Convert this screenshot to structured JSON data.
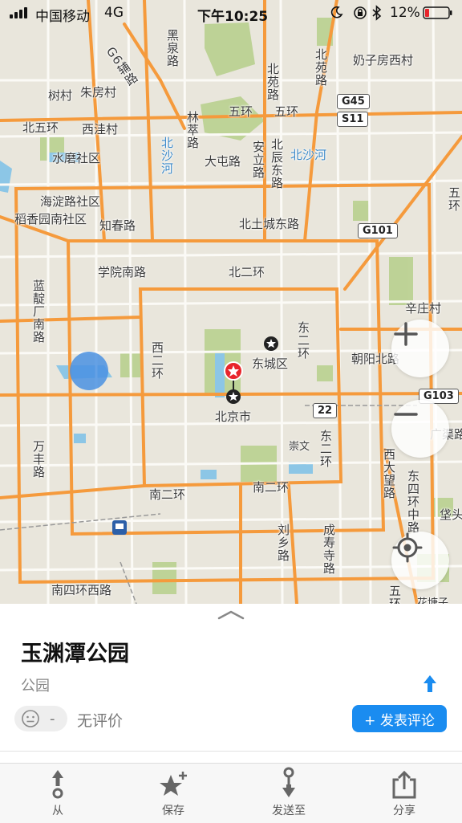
{
  "status_bar": {
    "carrier": "中国移动",
    "network": "4G",
    "time": "下午10:25",
    "battery": "12%"
  },
  "map": {
    "labels": {
      "heiquan": "黑泉路",
      "naizifang": "奶子房西村",
      "shufang": "树村",
      "zhufang": "朱房村",
      "beiwuhuan": "北五环",
      "xiwa": "西洼村",
      "wuhuan1": "五环",
      "wuhuan2": "五环",
      "dachun": "大屯路",
      "shuimo": "水磨社区",
      "haidian": "海淀路社区",
      "daoxiang": "稻香园南社区",
      "zhichun": "知春路",
      "beitucheng": "北土城东路",
      "xueyuan": "学院南路",
      "beierhuan": "北二环",
      "xinzhuang": "辛庄村",
      "dongcheng": "东城区",
      "chaoyang": "朝阳北路",
      "beijing": "北京市",
      "nanerhuan1": "南二环",
      "nanerhuan2": "南二环",
      "nansihuan": "南四环西路",
      "huatang": "花塘子",
      "chongwen": "崇文",
      "gaiqiao": "垡头",
      "guangqu": "广渠路",
      "lincui": "林萃路",
      "beiyuan": "北苑路",
      "anli": "安立路",
      "beichen": "北辰东路",
      "beishenshu": "北沙河",
      "xierhuan": "西二环",
      "dongerhuan": "东二环",
      "dongerhuan2": "东二环",
      "lianhua": "莲花池",
      "wanfeng": "万丰路",
      "liuxiang": "刘乡路",
      "chengshou": "成寿寺路",
      "xidawang": "西大望路",
      "dongsihuan": "东四环中路",
      "g6": "G6辅路",
      "wuhuanx": "五环",
      "lanyu": "蓝靛厂南路",
      "wuhuan_e": "五环"
    },
    "shields": {
      "g45": "G45",
      "s11": "S11",
      "g101": "G101",
      "g103": "G103",
      "r22": "22"
    },
    "zoom_in_label": "+",
    "zoom_out_label": "−"
  },
  "place": {
    "name": "玉渊潭公园",
    "category": "公园",
    "rating_placeholder": "-",
    "rating_text": "无评价",
    "review_button": "+ 发表评论"
  },
  "tabs": [
    {
      "label": "从",
      "icon": "from-pin-icon"
    },
    {
      "label": "保存",
      "icon": "star-plus-icon"
    },
    {
      "label": "发送至",
      "icon": "send-to-pin-icon"
    },
    {
      "label": "分享",
      "icon": "share-icon"
    }
  ],
  "colors": {
    "accent": "#1a8cf0",
    "road_major": "#f59a3c",
    "park": "#b7cf8e",
    "water": "#8bc4e6",
    "pin_red": "#e8252b"
  }
}
